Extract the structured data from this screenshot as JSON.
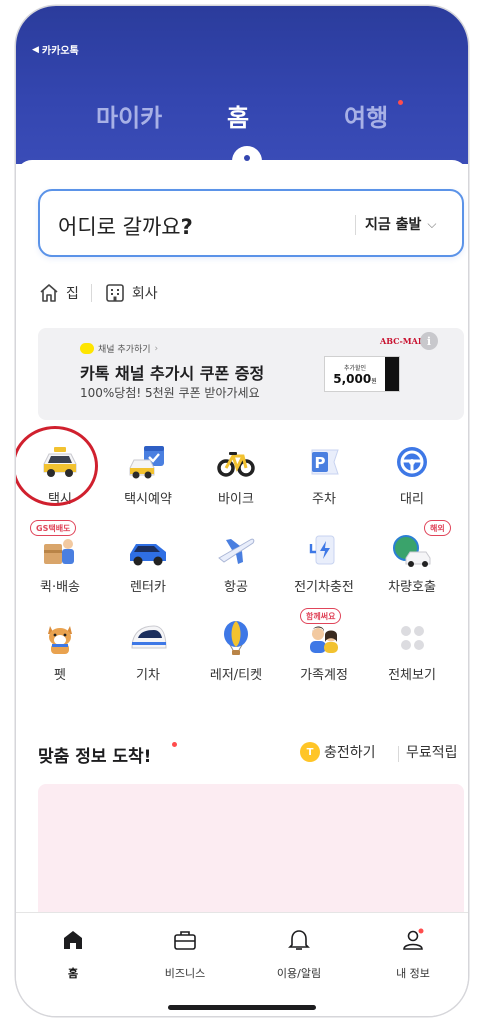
{
  "status": {
    "back_label": "카카오톡"
  },
  "top_tabs": [
    {
      "label": "마이카",
      "active": false
    },
    {
      "label": "홈",
      "active": true
    },
    {
      "label": "여행",
      "active": false,
      "has_dot": true
    }
  ],
  "search": {
    "prompt": "어디로 갈까요",
    "punct": "?",
    "depart_label": "지금 출발"
  },
  "quick_places": [
    {
      "label": "집",
      "icon": "home-outline-icon"
    },
    {
      "label": "회사",
      "icon": "building-outline-icon"
    }
  ],
  "banner": {
    "small_label": "채널 추가하기",
    "title": "카톡 채널 추가시 쿠폰 증정",
    "subtitle": "100%당첨! 5천원 쿠폰 받아가세요",
    "brand": "ABC-MART",
    "coupon_small": "추가할인",
    "coupon_amount": "5,000",
    "coupon_unit": "원",
    "info": "i"
  },
  "services": [
    {
      "label": "택시",
      "icon": "taxi-icon",
      "highlighted": true
    },
    {
      "label": "택시예약",
      "icon": "taxi-reservation-icon"
    },
    {
      "label": "바이크",
      "icon": "bike-icon"
    },
    {
      "label": "주차",
      "icon": "parking-icon"
    },
    {
      "label": "대리",
      "icon": "steering-wheel-icon"
    },
    {
      "label": "퀵·배송",
      "icon": "delivery-icon",
      "badge": "GS택배도"
    },
    {
      "label": "렌터카",
      "icon": "rental-car-icon"
    },
    {
      "label": "항공",
      "icon": "airplane-icon"
    },
    {
      "label": "전기차충전",
      "icon": "ev-charger-icon"
    },
    {
      "label": "차량호출",
      "icon": "car-call-icon",
      "badge": "해외"
    },
    {
      "label": "펫",
      "icon": "pet-icon"
    },
    {
      "label": "기차",
      "icon": "train-icon"
    },
    {
      "label": "레저/티켓",
      "icon": "balloon-icon"
    },
    {
      "label": "가족계정",
      "icon": "family-icon",
      "badge": "함께써요"
    },
    {
      "label": "전체보기",
      "icon": "view-all-icon"
    }
  ],
  "feed": {
    "title": "맞춤 정보 도착!",
    "charge_label": "충전하기",
    "coin_letter": "T",
    "free_label": "무료적립"
  },
  "bottom_nav": [
    {
      "label": "홈",
      "icon": "home-icon",
      "active": true
    },
    {
      "label": "비즈니스",
      "icon": "briefcase-icon"
    },
    {
      "label": "이용/알림",
      "icon": "bell-icon"
    },
    {
      "label": "내 정보",
      "icon": "person-icon",
      "has_dot": true
    }
  ],
  "colors": {
    "header": "#3446b0",
    "search_border": "#5b93e8",
    "highlight_ring": "#d0202e",
    "badge_red": "#e0455a",
    "feed_card": "#fcecf2"
  }
}
